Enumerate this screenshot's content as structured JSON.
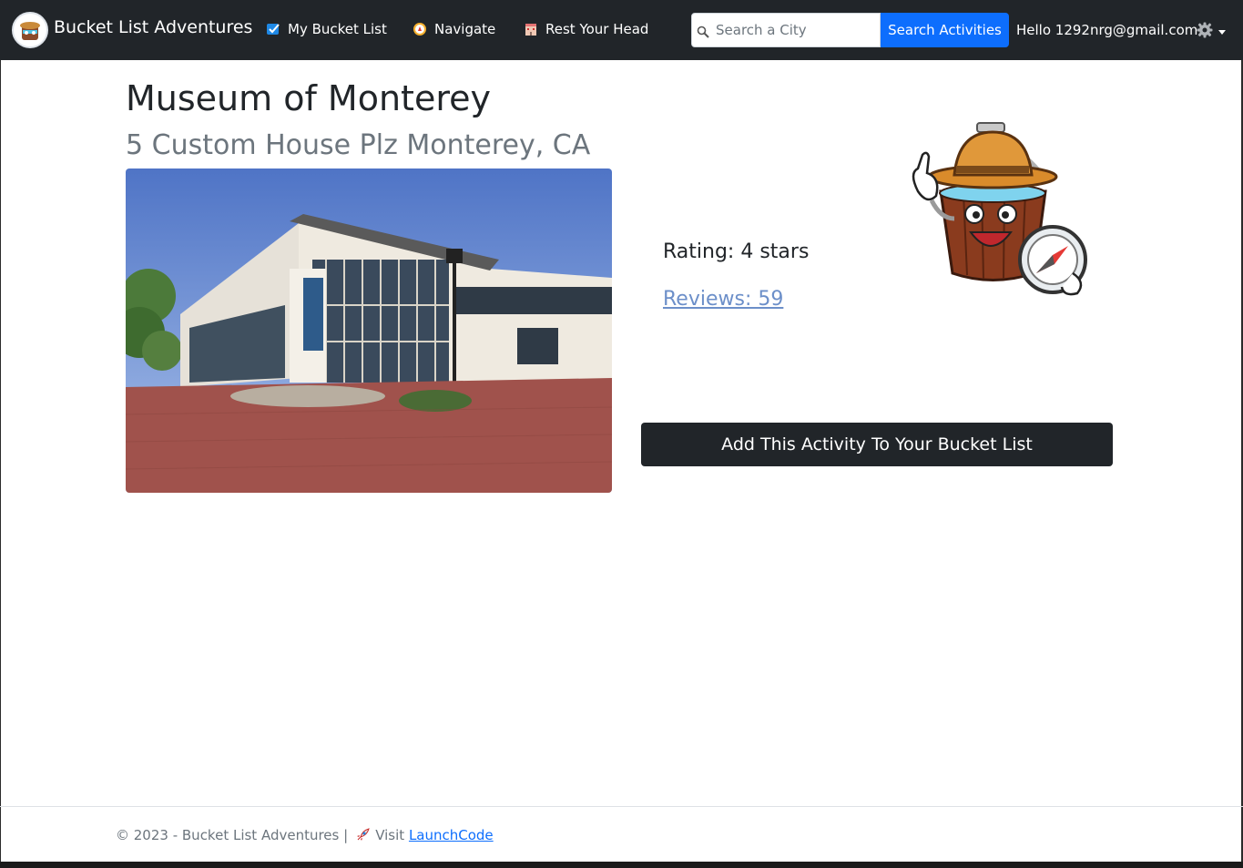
{
  "navbar": {
    "brand": "Bucket List Adventures",
    "items": [
      {
        "label": "My Bucket List",
        "icon": "checkbox-icon"
      },
      {
        "label": "Navigate",
        "icon": "compass-icon"
      },
      {
        "label": "Rest Your Head",
        "icon": "hotel-icon"
      }
    ],
    "search": {
      "placeholder": "Search a City",
      "value": "",
      "button_label": "Search Activities"
    },
    "greeting": "Hello 1292nrg@gmail.com!",
    "settings_icon": "gear-icon"
  },
  "activity": {
    "name": "Museum of Monterey",
    "address": "5 Custom House Plz Monterey, CA",
    "rating": "Rating: 4 stars",
    "reviews": "Reviews: 59",
    "add_button": "Add This Activity To Your Bucket List"
  },
  "footer": {
    "copyright": "© 2023 - Bucket List Adventures |",
    "visit": "Visit",
    "link": "LaunchCode"
  },
  "colors": {
    "navbar": "#212529",
    "search_button": "#0d6efd",
    "reviews_link": "#6c8fc9",
    "subtitle": "#6c757d"
  }
}
